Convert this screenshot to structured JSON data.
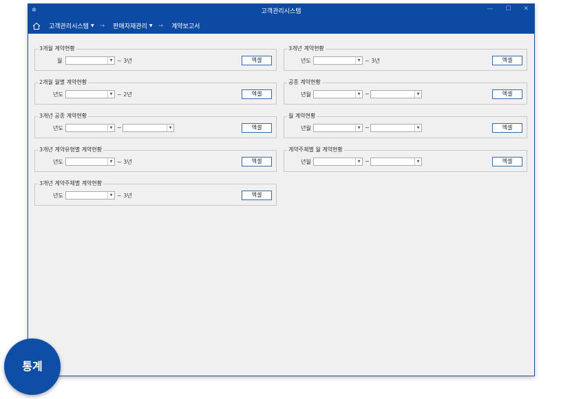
{
  "window": {
    "title": "고객관리시스템",
    "minimize": "—",
    "maximize": "☐",
    "close": "✕"
  },
  "nav": {
    "crumbs": [
      "고객관리시스템",
      "판매자재관리",
      "계약보고서"
    ],
    "separator": "→",
    "caret": "▼"
  },
  "groups": [
    {
      "title": "3개월 계약현황",
      "label": "월",
      "suffix": "~ 3년",
      "button": "엑셀"
    },
    {
      "title": "3개년 계약현황",
      "label": "년도",
      "suffix": "~ 3년",
      "button": "엑셀"
    },
    {
      "title": "2개월 월별 계약현황",
      "label": "년도",
      "suffix": "~ 2년",
      "button": "엑셀"
    },
    {
      "title": "공종 계약현황",
      "label": "년월",
      "range_sep": "~",
      "button": "엑셀"
    },
    {
      "title": "3개년 공종 계약현황",
      "label": "년도",
      "range_sep": "~",
      "button": "엑셀"
    },
    {
      "title": "월 계약현황",
      "label": "년월",
      "range_sep": "~",
      "button": "엑셀"
    },
    {
      "title": "3개년 계약유형별 계약현황",
      "label": "년도",
      "suffix": "~ 3년",
      "button": "엑셀"
    },
    {
      "title": "계약주체별 월 계약현황",
      "label": "년월",
      "range_sep": "~",
      "button": "엑셀"
    },
    {
      "title": "3개년 계약주체별 계약현황",
      "label": "년도",
      "suffix": "~ 3년",
      "button": "엑셀"
    }
  ],
  "combo_arrow": "▼",
  "badge": "통계"
}
